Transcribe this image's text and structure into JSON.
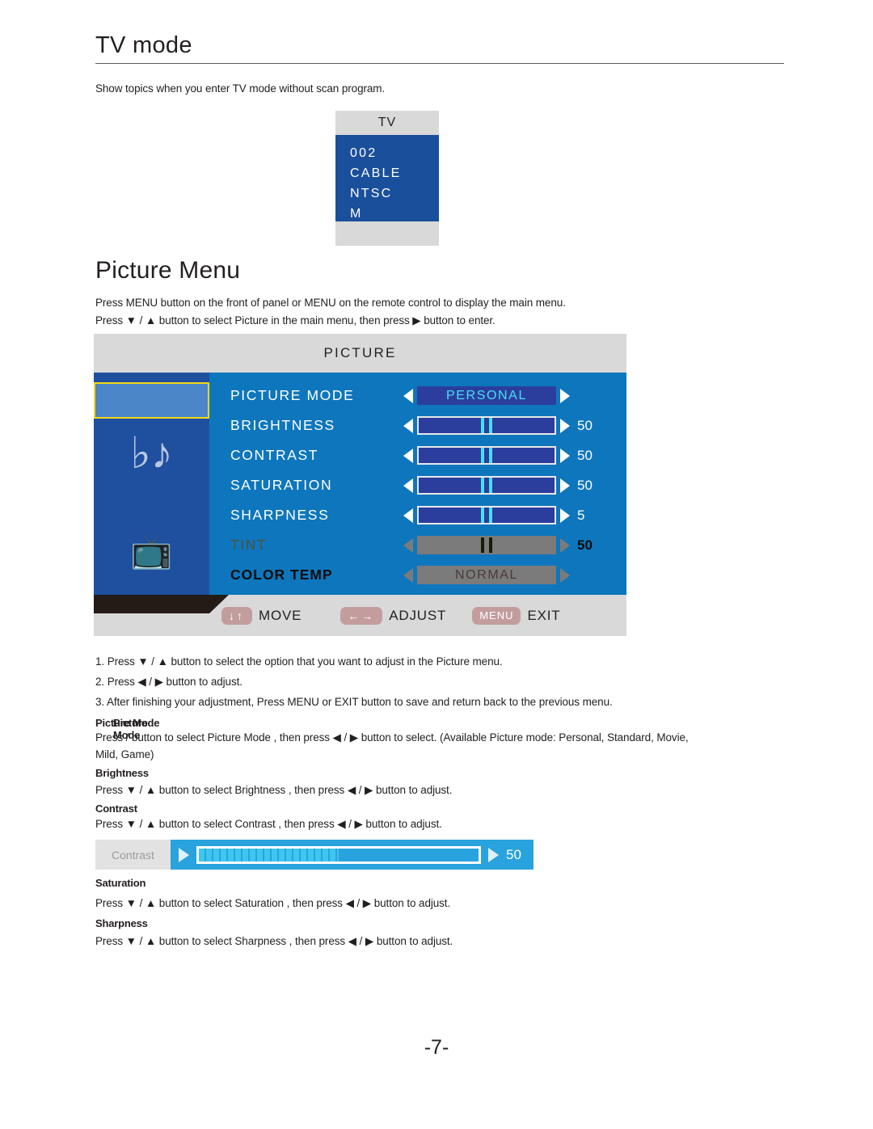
{
  "page": {
    "title": "TV mode",
    "intro": "Show topics when you enter TV mode without scan program.",
    "page_number": "-7-"
  },
  "tv_info_box": {
    "header": "TV",
    "lines": [
      "002",
      "CABLE",
      "NTSC",
      "M"
    ]
  },
  "picture_menu": {
    "heading": "Picture Menu",
    "desc_line_1": "Press MENU button on the front of panel or MENU on the remote control to display the main menu.",
    "desc_line_2": "Press ▼ / ▲ button to select Picture  in the main menu,  then press ▶ button to enter."
  },
  "osd": {
    "title": "PICTURE",
    "sidebar": {
      "tab_selected_label": "",
      "icons": [
        "music-note-icon",
        "tv-icon"
      ]
    },
    "rows": [
      {
        "label": "PICTURE MODE",
        "type": "option",
        "value": "PERSONAL",
        "number": "",
        "disabled": false
      },
      {
        "label": "BRIGHTNESS",
        "type": "slider",
        "value": "50",
        "number": "50",
        "percent": 50,
        "disabled": false
      },
      {
        "label": "CONTRAST",
        "type": "slider",
        "value": "50",
        "number": "50",
        "percent": 50,
        "disabled": false
      },
      {
        "label": "SATURATION",
        "type": "slider",
        "value": "50",
        "number": "50",
        "percent": 50,
        "disabled": false
      },
      {
        "label": "SHARPNESS",
        "type": "slider",
        "value": "5",
        "number": "5",
        "percent": 50,
        "disabled": false
      },
      {
        "label": "TINT",
        "type": "slider",
        "value": "50",
        "number": "50",
        "percent": 50,
        "disabled": true
      },
      {
        "label": "COLOR TEMP",
        "type": "option",
        "value": "NORMAL",
        "number": "",
        "disabled": true
      }
    ],
    "footer": {
      "move_icon": "↓↑",
      "move_label": "MOVE",
      "adjust_icon": "←→",
      "adjust_label": "ADJUST",
      "menu_pill": "MENU",
      "exit_label": "EXIT"
    },
    "colors": {
      "panel_blue": "#0e76bc",
      "sidebar_blue": "#1f4f9f",
      "header_gray": "#d9d9d9",
      "highlight_yellow": "#f5d916",
      "value_cyan": "#46e0f0",
      "pill_mauve": "#c39d9d"
    }
  },
  "steps": [
    "1. Press ▼ / ▲ button to select the option   that you  want to adjust in the Picture  menu.",
    "2. Press ◀ / ▶ button to adjust.",
    "3. After finishing your adjustment, Press  MENU or EXIT button to save and return back to the previous menu."
  ],
  "sections": [
    {
      "heading": "Picture Mode",
      "heading_ghost": "Picture Mode",
      "lines": [
        "Press      /     button to select  Picture Mode ,  then press  ◀ / ▶ button to select. (Available Picture mode: Personal, Standard, Movie,",
        "Mild, Game)"
      ]
    },
    {
      "heading": "Brightness",
      "lines": [
        "Press ▼ / ▲ button to select Brightness ,  then press  ◀ / ▶ button to adjust."
      ]
    },
    {
      "heading": "Contrast",
      "lines": [
        "Press ▼ / ▲ button to select Contrast ,  then press  ◀ / ▶ button to adjust."
      ]
    },
    {
      "heading": "Saturation",
      "lines": [
        "Press ▼ / ▲ button to select Saturation ,  then press ◀ / ▶ button to adjust."
      ]
    },
    {
      "heading": "Sharpness",
      "lines": [
        "Press ▼ / ▲ button to select Sharpness ,  then press ◀ / ▶ button to adjust."
      ]
    }
  ],
  "contrast_widget": {
    "label": "Contrast",
    "value": "50",
    "percent": 50
  }
}
